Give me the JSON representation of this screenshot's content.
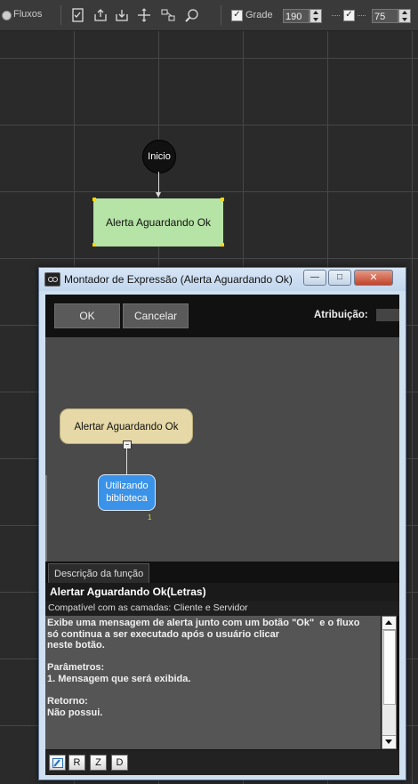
{
  "toolbar": {
    "fluxos_label": "Fluxos",
    "grade_label": "Grade",
    "grade_value": "190",
    "second_value": "75",
    "grade_checked": true,
    "second_checked": true,
    "dots": "·····"
  },
  "canvas": {
    "start_node_label": "Inicio",
    "alert_node_label": "Alerta Aguardando Ok",
    "start_node_color": "#111111",
    "alert_node_color": "#b6e3a6"
  },
  "dialog": {
    "title": "Montador de Expressão (Alerta Aguardando Ok)",
    "window_buttons": {
      "minimize": "—",
      "maximize": "□",
      "close": "✕"
    },
    "ok_label": "OK",
    "cancel_label": "Cancelar",
    "attribution_label": "Atribuição:",
    "expression": {
      "function_node_label": "Alertar Aguardando Ok",
      "collapse_symbol": "−",
      "param_node_label": "Utilizando biblioteca",
      "param_index": "1",
      "function_color": "#e6d9a7",
      "param_color": "#3a93e8"
    },
    "description": {
      "tab_label": "Descrição da função",
      "function_signature": "Alertar Aguardando Ok(Letras)",
      "compatibility": "Compatível com as camadas: Cliente e Servidor",
      "body_text": "Exibe uma mensagem de alerta junto com um botão \"Ok\"  e o fluxo\nsó continua a ser executado após o usuário clicar\nneste botão.\n\nParâmetros:\n1. Mensagem que será exibida.\n\nRetorno:\nNão possui."
    },
    "bottom_buttons": {
      "edit_icon": "edit-icon",
      "r_label": "R",
      "z_label": "Z",
      "d_label": "D"
    }
  }
}
